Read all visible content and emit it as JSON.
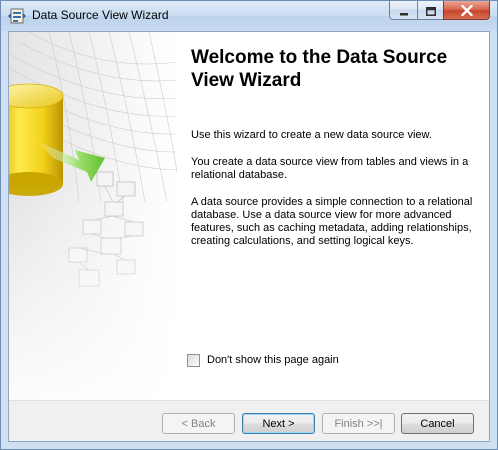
{
  "window": {
    "title": "Data Source View Wizard",
    "app_icon": "wizard-app-icon"
  },
  "caption_buttons": {
    "minimize_icon": "minimize-icon",
    "maximize_icon": "maximize-icon",
    "close_icon": "close-icon"
  },
  "page": {
    "heading": "Welcome to the Data Source View Wizard",
    "paragraphs": [
      "Use this wizard to create a new data source view.",
      "You create a data source view from tables and views in a relational database.",
      "A data source provides a simple connection to a relational database. Use a data source view for more advanced features, such as caching metadata, adding relationships, creating calculations, and setting logical keys."
    ],
    "checkbox": {
      "label": "Don't show this page again",
      "checked": false
    }
  },
  "buttons": {
    "back": "< Back",
    "next": "Next >",
    "finish": "Finish >>|",
    "cancel": "Cancel"
  },
  "colors": {
    "accent_yellow": "#f0d020",
    "accent_green": "#7ccf4a",
    "close_red": "#c74530"
  }
}
